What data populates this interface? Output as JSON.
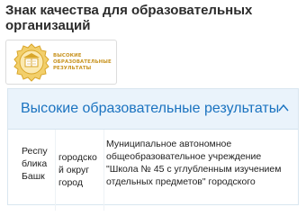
{
  "page": {
    "title": "Знак качества для образовательных организаций"
  },
  "badge": {
    "icon": "medal-book-icon",
    "text_lines": [
      "ВЫСОКИЕ",
      "ОБРАЗОВАТЕЛЬНЫЕ",
      "РЕЗУЛЬТАТЫ"
    ],
    "colors": {
      "gold": "#d9a62a",
      "gold_light": "#f2cf6b",
      "text": "#c8931f"
    }
  },
  "accordion": {
    "title": "Высокие образовательные результаты",
    "expanded": true,
    "toggle_icon": "chevron-up-icon",
    "colors": {
      "header_bg": "#eaf3fb",
      "title": "#1b73c0",
      "border": "#d9e6f0"
    },
    "rows": [
      {
        "region_lines": [
          "Респу",
          "блика",
          "Башк"
        ],
        "municipality_lines": [
          "городско",
          "й округ",
          "город"
        ],
        "organization_lines": [
          "Муниципальное автономное",
          "общеобразовательное учреждение",
          "\"Школа № 45 с углубленным изучением",
          "отдельных предметов\" городского"
        ]
      }
    ]
  }
}
